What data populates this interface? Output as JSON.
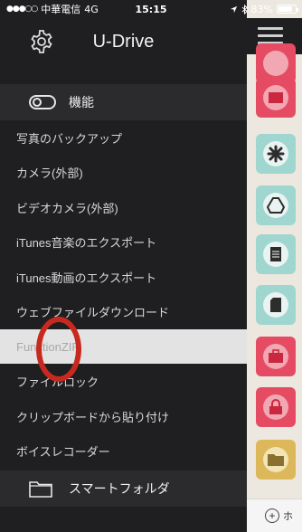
{
  "status_bar": {
    "signal": "●●●○○",
    "carrier": "中華電信",
    "network": "4G",
    "time": "15:15",
    "battery": "83%",
    "battery_level": 0.83
  },
  "menu": {
    "title": "U-Drive",
    "section_functions": "機能",
    "items": [
      "写真のバックアップ",
      "カメラ(外部)",
      "ビデオカメラ(外部)",
      "iTunes音楽のエクスポート",
      "iTunes動画のエクスポート",
      "ウェブファイルダウンロード",
      "FunctionZIP",
      "ファイルロック",
      "クリップボードから貼り付け",
      "ボイスレコーダー"
    ],
    "section_smart_folder": "スマートフォルダ"
  },
  "right_panel": {
    "bottom_label": "ホ"
  },
  "colors": {
    "menu_bg": "#1f1f21",
    "section_bg": "#2b2b2e",
    "selected_bg": "#e3e3e3",
    "highlight": "#c8291f",
    "tile_pink": "#e54b63",
    "tile_teal": "#9fd6cf",
    "tile_yellow": "#ddb85a"
  }
}
